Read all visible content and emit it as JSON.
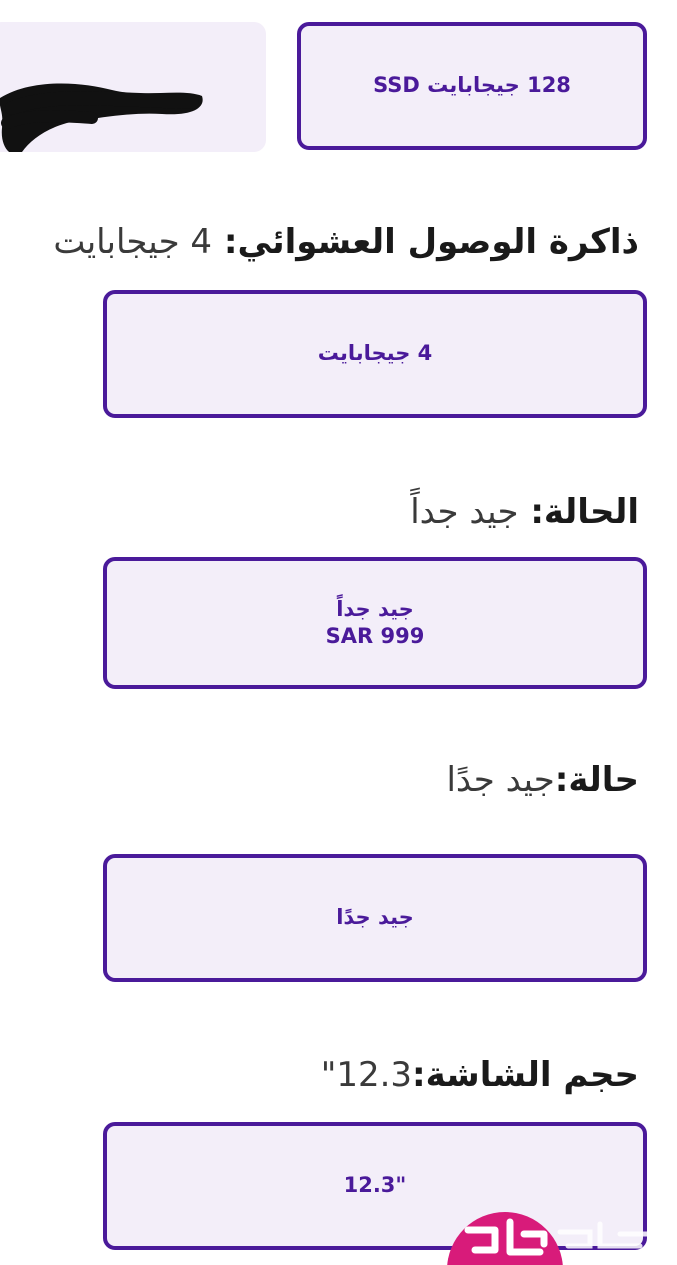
{
  "storage": {
    "option_selected": "128 جيجابايت SSD"
  },
  "ram": {
    "heading_label": "ذاكرة الوصول العشوائي:",
    "heading_value": "4 جيجابايت",
    "option": "4 جيجابايت"
  },
  "condition": {
    "heading_label": "الحالة:",
    "heading_value": "جيد جداً",
    "option_label": "جيد جداً",
    "option_price": "SAR 999"
  },
  "condition_alt": {
    "heading_label": "حالة:",
    "heading_value": "جيد جدًا",
    "option": "جيد جدًا"
  },
  "screen_size": {
    "heading_label": "حجم الشاشة:",
    "heading_value": "12.3\"",
    "option": "12.3\""
  },
  "colors": {
    "accent": "#4a1a9a",
    "option_bg": "#f3eef9",
    "watermark": "#d81b7a"
  },
  "icons": {
    "redaction": "redaction-scribble",
    "watermark": "haraj-watermark-logo"
  }
}
